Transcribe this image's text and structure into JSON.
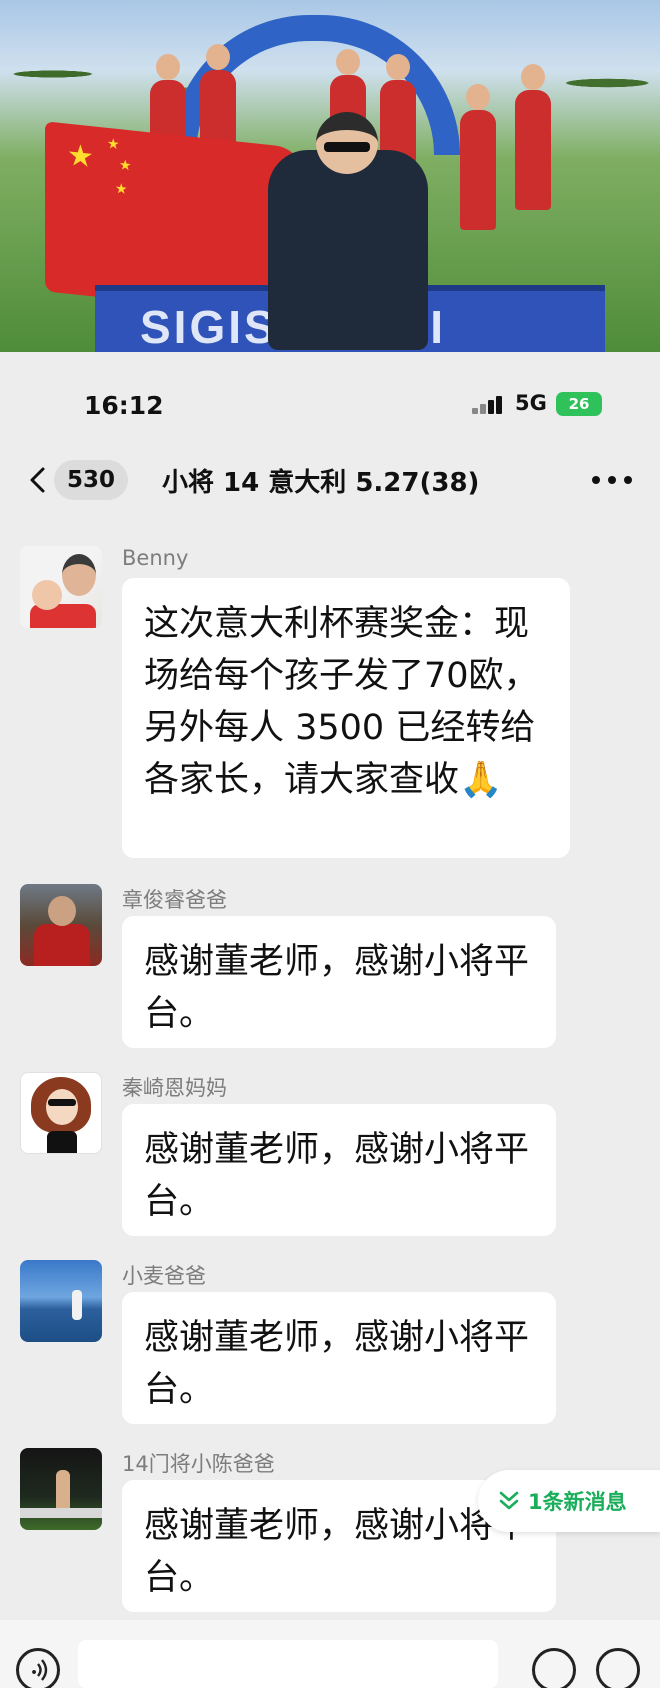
{
  "status_bar": {
    "time": "16:12",
    "network": "5G",
    "battery": "26"
  },
  "photo": {
    "sponsor_text": "SIGISMONDI"
  },
  "nav": {
    "back_count": "530",
    "title": "小将 14 意大利 5.27(38)"
  },
  "messages": [
    {
      "sender": "Benny",
      "text": "这次意大利杯赛奖金：现场给每个孩子发了70欧，另外每人 3500 已经转给各家长，请大家查收🙏"
    },
    {
      "sender": "章俊睿爸爸",
      "text": "感谢董老师，感谢小将平台。"
    },
    {
      "sender": "秦崎恩妈妈",
      "text": "感谢董老师，感谢小将平台。"
    },
    {
      "sender": "小麦爸爸",
      "text": "感谢董老师，感谢小将平台。"
    },
    {
      "sender": "14门将小陈爸爸",
      "text": "感谢董老师，感谢小将平台。"
    }
  ],
  "new_messages": {
    "label": "1条新消息"
  },
  "icons": {
    "back": "chevron-left-icon",
    "more": "more-dots-icon",
    "new_messages": "double-chevron-down-icon",
    "voice": "voice-icon",
    "emoji": "emoji-icon",
    "plus": "plus-icon"
  },
  "colors": {
    "accent": "#1aad5a",
    "bubble": "#ffffff",
    "background": "#ededed",
    "battery": "#2fc15a"
  }
}
